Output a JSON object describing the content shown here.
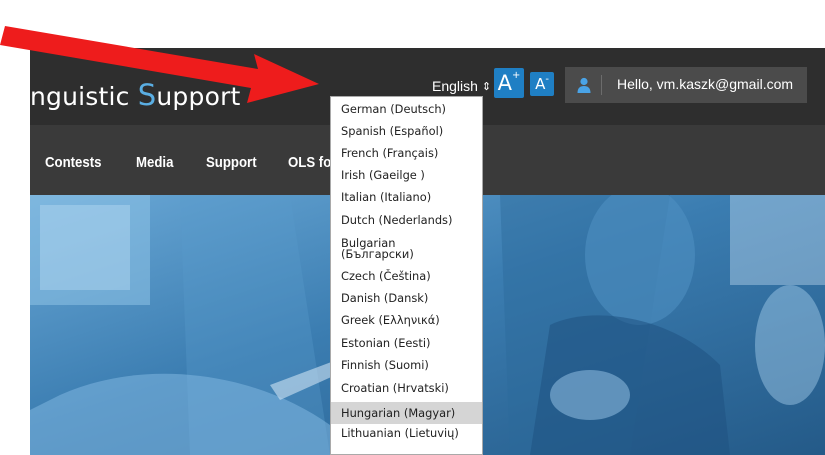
{
  "header": {
    "brand_part1": "nguistic ",
    "brand_accent": "S",
    "brand_part2": "upport",
    "language_current": "English",
    "language_caret": "⇕",
    "font_increase": "A",
    "font_increase_sup": "+",
    "font_decrease": "A",
    "font_decrease_sup": "-",
    "user_greeting": "Hello, vm.kaszk@gmail.com"
  },
  "nav": {
    "items": [
      {
        "label": "Contests"
      },
      {
        "label": "Media"
      },
      {
        "label": "Support"
      },
      {
        "label": "OLS fo"
      }
    ]
  },
  "language_dropdown": {
    "options": [
      {
        "label": "German (Deutsch)"
      },
      {
        "label": "Spanish (Español)"
      },
      {
        "label": "French (Français)"
      },
      {
        "label": "Irish (Gaeilge )"
      },
      {
        "label": "Italian (Italiano)"
      },
      {
        "label": "Dutch (Nederlands)"
      },
      {
        "label": "Bulgarian\n(Български)"
      },
      {
        "label": "Czech (Čeština)"
      },
      {
        "label": "Danish (Dansk)"
      },
      {
        "label": "Greek (Ελληνικά)"
      },
      {
        "label": "Estonian (Eesti)"
      },
      {
        "label": "Finnish (Suomi)"
      },
      {
        "label": "Croatian (Hrvatski)"
      },
      {
        "label": "Hungarian (Magyar)"
      },
      {
        "label": "Lithuanian (Lietuvių)"
      }
    ],
    "selected_label": "Hungarian (Magyar)"
  },
  "colors": {
    "header_bg": "#2e2e2e",
    "nav_bg": "#3a3a3a",
    "accent_blue": "#1f7fc4",
    "annotation_arrow": "#ee1c1c"
  },
  "icons": {
    "user": "user-icon",
    "annotation": "red-arrow-icon"
  }
}
